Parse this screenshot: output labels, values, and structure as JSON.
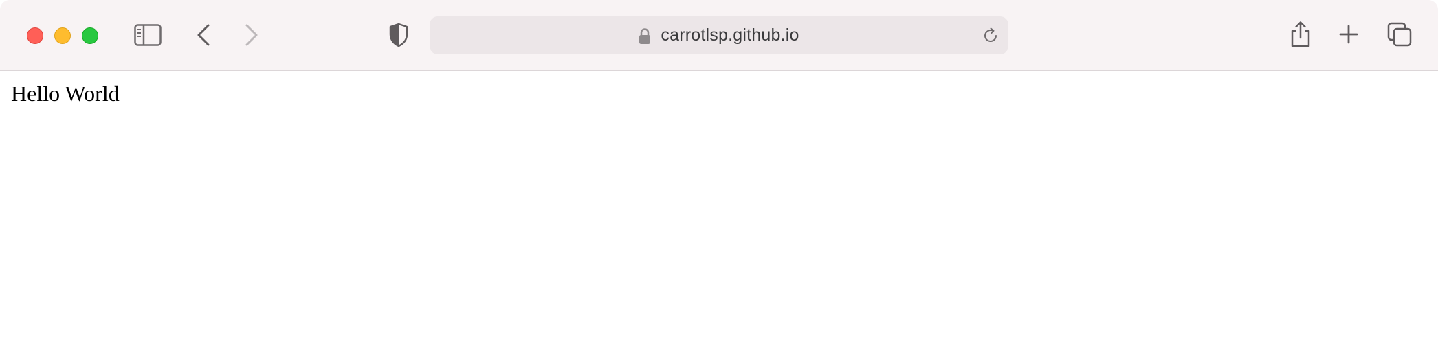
{
  "browser": {
    "window_controls": {
      "close_color": "#ff5f57",
      "minimize_color": "#febc2e",
      "maximize_color": "#28c840"
    },
    "toolbar": {
      "sidebar_icon": "sidebar-icon",
      "back_icon": "chevron-left-icon",
      "forward_icon": "chevron-right-icon",
      "privacy_icon": "shield-icon",
      "share_icon": "share-icon",
      "new_tab_icon": "plus-icon",
      "tab_overview_icon": "tabs-overview-icon"
    },
    "address_bar": {
      "url": "carrotlsp.github.io",
      "secure": true,
      "lock_icon": "lock-icon",
      "reload_icon": "reload-icon"
    }
  },
  "page": {
    "body_text": "Hello World"
  }
}
